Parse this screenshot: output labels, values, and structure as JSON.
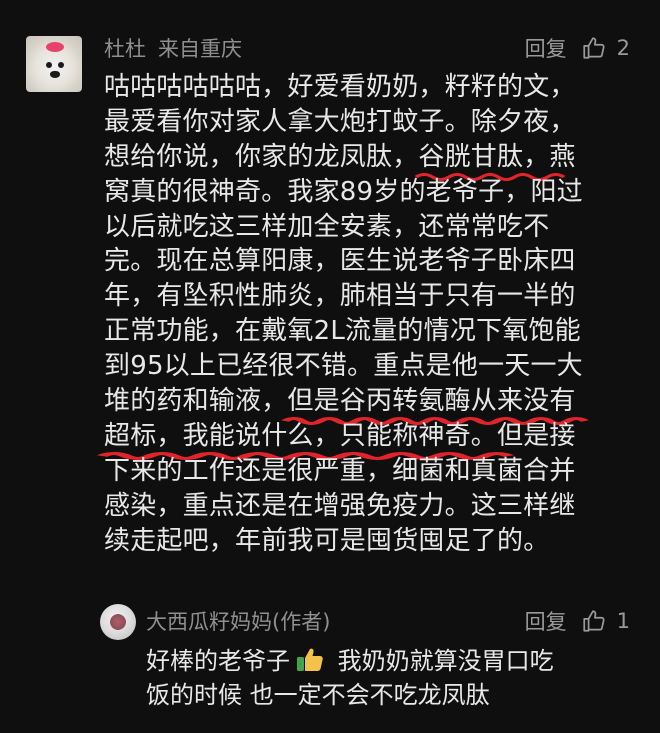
{
  "comment": {
    "username": "杜杜",
    "location": "来自重庆",
    "reply_label": "回复",
    "like_count": "2",
    "icons": {
      "avatar": "dog-avatar",
      "like": "thumbs-up-icon"
    },
    "lines": [
      "咕咕咕咕咕咕，好爱看奶奶，籽籽的文，",
      "最爱看你对家人拿大炮打蚊子。除夕夜，",
      "想给你说，你家的龙凤肽，谷胱甘肽，燕",
      "窝真的很神奇。我家89岁的老爷子，阳过",
      "以后就吃这三样加全安素，还常常吃不",
      "完。现在总算阳康，医生说老爷子卧床四",
      "年，有坠积性肺炎，肺相当于只有一半的",
      "正常功能，在戴氧2L流量的情况下氧饱能",
      "到95以上已经很不错。重点是他一天一大",
      "堆的药和输液，但是谷丙转氨酶从来没有",
      "超标，我能说什么，只能称神奇。但是接",
      "下来的工作还是很严重，细菌和真菌合并",
      "感染，重点还是在增强免疫力。这三样继",
      "续走起吧，年前我可是囤货囤足了的。"
    ],
    "highlights": {
      "line3_pre": "想给你说，你家的龙凤肽，",
      "line3_mark": "谷胱甘肽，",
      "line3_post": "燕",
      "line10_pre": "堆的药和输液，",
      "line10_mark": "但是谷丙转氨酶从来没有",
      "line11_mark": "超标，我能说什么，只能称神奇。",
      "line11_post": "但是接"
    },
    "underline_color": "#e0242a"
  },
  "reply": {
    "username": "大西瓜籽妈妈(作者)",
    "reply_label": "回复",
    "like_count": "1",
    "icons": {
      "avatar": "watermelon-avatar",
      "like": "thumbs-up-icon",
      "emoji": "thumbs-up-emoji"
    },
    "line1_pre": "好棒的老爷子",
    "line1_post": " 我奶奶就算没胃口吃",
    "line2": "饭的时候 也一定不会不吃龙凤肽"
  }
}
